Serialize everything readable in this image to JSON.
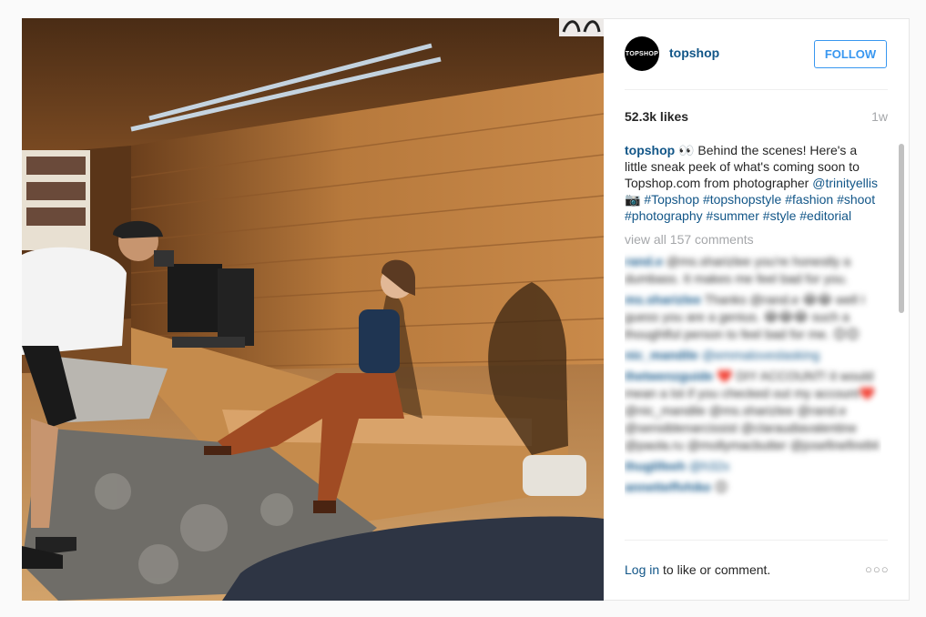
{
  "post": {
    "image_alt": "Behind the scenes photoshoot: photographer shooting a model seated on a wooden bench",
    "username": "topshop",
    "avatar_text": "TOPSHOP",
    "follow_label": "FOLLOW",
    "likes": "52.3k likes",
    "time": "1w",
    "caption": {
      "username": "topshop",
      "emoji": "👀",
      "text_1": " Behind the scenes! Here's a little sneak peek of what's coming soon to Topshop.com from photographer ",
      "mention": "@trinityellis",
      "camera_emoji": "📷",
      "tags": [
        "#Topshop",
        "#topshopstyle",
        "#fashion",
        "#shoot",
        "#photography",
        "#summer",
        "#style",
        "#editorial"
      ]
    },
    "view_all": "view all 157 comments",
    "comments": [
      {
        "user": "rand.e",
        "text": "@ms.sharizlee you're honestly a dumbass. It makes me feel bad for you."
      },
      {
        "user": "ms.sharizlee",
        "text": "Thanks @rand.e 😂😂 well I guess you are a genius. 😂😂😂 such a thoughtful person to feel bad for me. 😊😊"
      },
      {
        "user": "nic_mandile",
        "text": "@emmaloveslasking"
      },
      {
        "user": "thetwenzguide",
        "text": "❤️ DIY ACCOUNT! it would mean a lot if you checked out my account❤️ @nic_mandile @ms.sharizlee @rand.e @sensiblenarcissist @claraudiavalentine @paola.ru @mollymacbutter @josefinefire84"
      },
      {
        "user": "thuglifeeh",
        "text": "@h32x"
      },
      {
        "user": "annetteffvhike",
        "text": "😊"
      }
    ],
    "footer": {
      "login": "Log in",
      "rest": " to like or comment.",
      "more": "○○○"
    }
  }
}
